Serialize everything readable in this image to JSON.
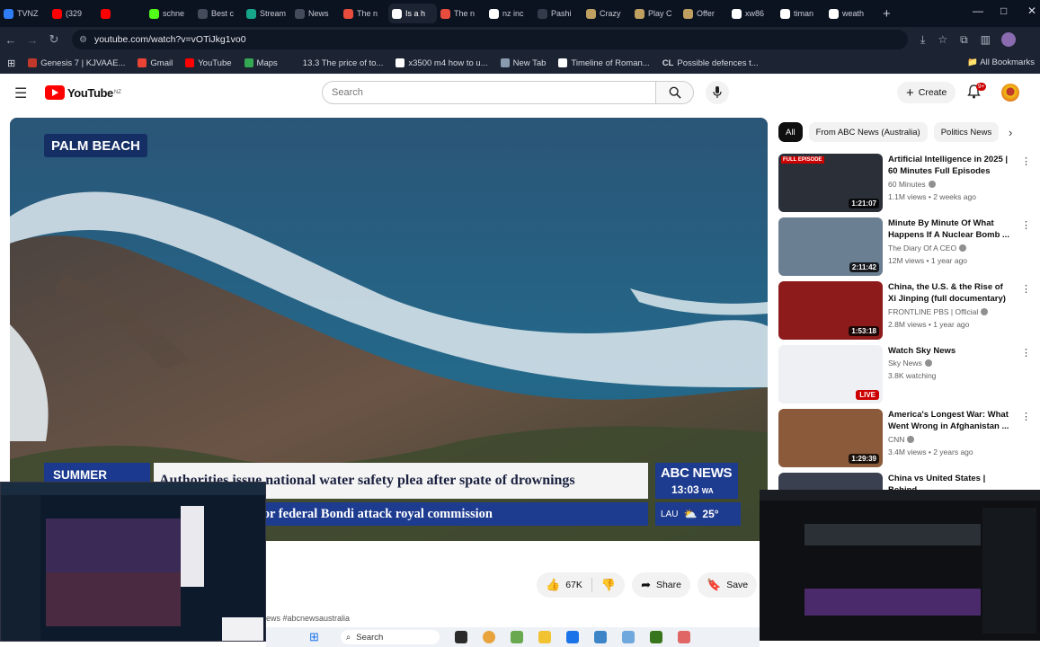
{
  "browser": {
    "tabs": [
      {
        "label": "TVNZ",
        "color": "#2f7ef7"
      },
      {
        "label": "(329",
        "color": "#ff0000"
      },
      {
        "label": "",
        "color": "#ff0000"
      },
      {
        "label": "schne",
        "color": "#53fc18"
      },
      {
        "label": "Best c",
        "color": "#444b5a"
      },
      {
        "label": "Stream",
        "color": "#17a589"
      },
      {
        "label": "News",
        "color": "#444b5a"
      },
      {
        "label": "The n",
        "color": "#e74c3c"
      },
      {
        "label": "Is a h",
        "color": "#ffffff"
      },
      {
        "label": "The n",
        "color": "#e74c3c"
      },
      {
        "label": "nz inc",
        "color": "#ffffff"
      },
      {
        "label": "Pashi",
        "color": "#333a4a"
      },
      {
        "label": "Crazy",
        "color": "#c0a060"
      },
      {
        "label": "Play C",
        "color": "#c0a060"
      },
      {
        "label": "Offer",
        "color": "#c0a060"
      },
      {
        "label": "xw86",
        "color": "#ffffff"
      },
      {
        "label": "timan",
        "color": "#ffffff"
      },
      {
        "label": "weath",
        "color": "#ffffff"
      }
    ],
    "url": "youtube.com/watch?v=vOTiJkg1vo0",
    "bookmarks": [
      {
        "label": "Genesis 7 | KJVAAE...",
        "color": "#c0392b"
      },
      {
        "label": "Gmail",
        "color": "#ea4335"
      },
      {
        "label": "YouTube",
        "color": "#ff0000"
      },
      {
        "label": "Maps",
        "color": "#34a853"
      },
      {
        "label": "13.3 The price of to...",
        "color": "#1c2433"
      },
      {
        "label": "x3500 m4 how to u...",
        "color": "#ffffff"
      },
      {
        "label": "New Tab",
        "color": "#8a9bb0"
      },
      {
        "label": "Timeline of Roman...",
        "color": "#ffffff"
      },
      {
        "label": "Possible defences t...",
        "color": "#1c2433"
      }
    ],
    "bookmark_prefix_cl": "CL",
    "all_bookmarks": "All Bookmarks"
  },
  "youtube": {
    "logo_text": "YouTube",
    "logo_region": "NZ",
    "search_placeholder": "Search",
    "create_label": "Create",
    "notification_count": "9+"
  },
  "player": {
    "location": "PALM BEACH",
    "program_tag": "SUMMER",
    "headline": "Authorities issue national water safety plea after spate of drownings",
    "ticker": "all for federal Bondi attack royal commission",
    "brand": "ABC NEWS",
    "time": "13:03",
    "timezone": "WA",
    "weather_city": "LAU",
    "weather_temp": "25°"
  },
  "actions": {
    "likes": "67K",
    "share": "Share",
    "save": "Save"
  },
  "hashtag": "ews #abcnewsaustralia",
  "chips": [
    {
      "label": "All",
      "active": true
    },
    {
      "label": "From ABC News (Australia)",
      "active": false
    },
    {
      "label": "Politics News",
      "active": false
    }
  ],
  "recommendations": [
    {
      "title": "Artificial Intelligence in 2025 | 60 Minutes Full Episodes",
      "channel": "60 Minutes",
      "meta": "1.1M views • 2 weeks ago",
      "duration": "1:21:07",
      "badge": "FULL EPISODE",
      "thumb_color": "#2b2f38"
    },
    {
      "title": "Minute By Minute Of What Happens If A Nuclear Bomb ...",
      "channel": "The Diary Of A CEO",
      "meta": "12M views • 1 year ago",
      "duration": "2:11:42",
      "thumb_color": "#6b7f92"
    },
    {
      "title": "China, the U.S. & the Rise of Xi Jinping (full documentary) | ...",
      "channel": "FRONTLINE PBS | Official",
      "meta": "2.8M views • 1 year ago",
      "duration": "1:53:18",
      "thumb_color": "#8e1b1b"
    },
    {
      "title": "Watch Sky News",
      "channel": "Sky News",
      "meta": "3.8K watching",
      "live": "LIVE",
      "thumb_color": "#eef0f4"
    },
    {
      "title": "America's Longest War: What Went Wrong in Afghanistan ...",
      "channel": "CNN",
      "meta": "3.4M views • 2 years ago",
      "duration": "1:29:39",
      "thumb_color": "#8a5a3b"
    },
    {
      "title": "China vs United States | Behind",
      "channel": "",
      "meta": "",
      "thumb_color": "#3a4050"
    }
  ],
  "taskbar": {
    "search_label": "Search"
  }
}
